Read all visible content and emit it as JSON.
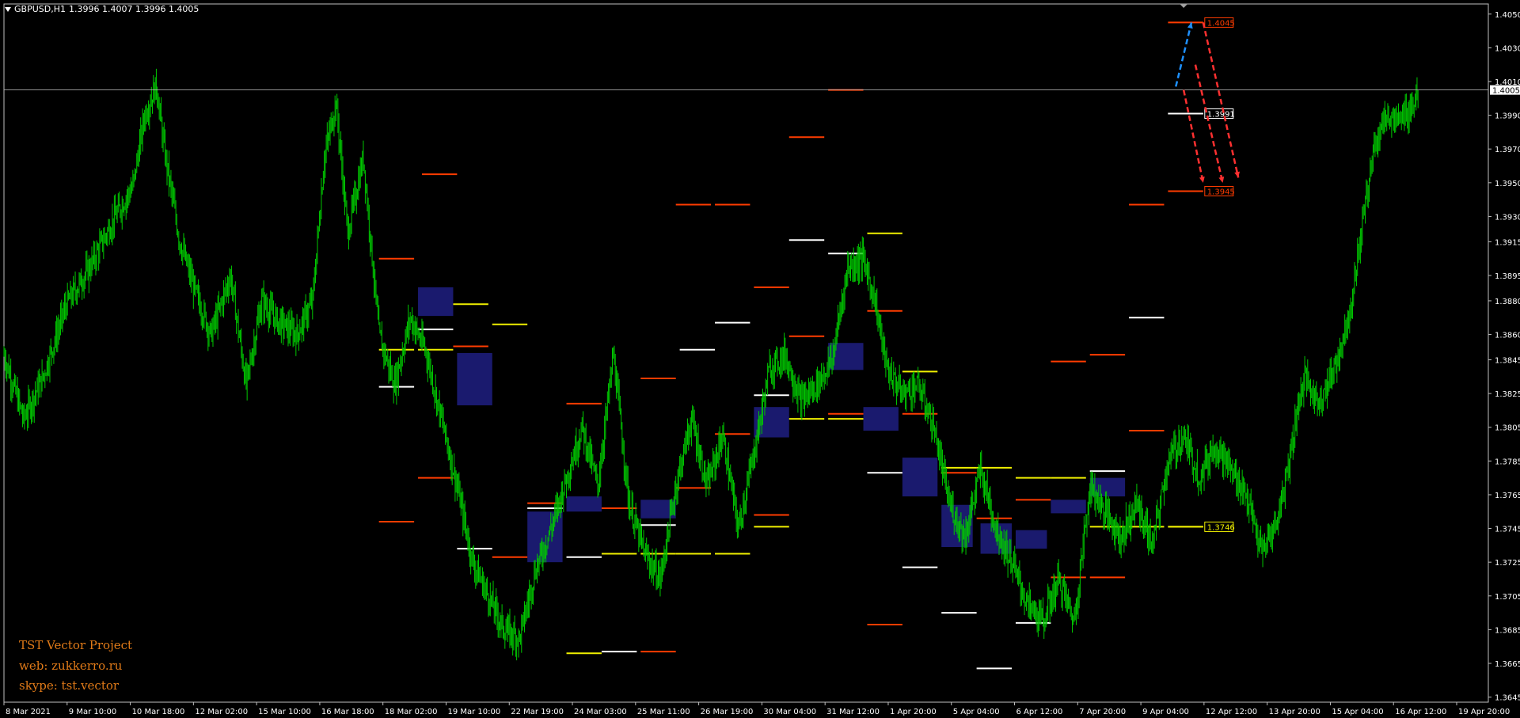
{
  "symbol_header": {
    "symbol": "GBPUSD,H1",
    "ohlc": "1.3996 1.4007 1.3996 1.4005"
  },
  "info_block": {
    "line1": "TST Vector Project",
    "line2": "web: zukkerro.ru",
    "line3": "skype: tst.vector"
  },
  "colors": {
    "background": "#000000",
    "candles": "#00c800",
    "grid_frame": "#c0c0c0",
    "level_red": "#ff3c00",
    "level_white": "#ffffff",
    "level_yellow": "#f0f000",
    "zone_fill": "#1a1a6e",
    "arrow_blue": "#1e90ff",
    "arrow_red": "#ff3030",
    "text_orange": "#e07a18"
  },
  "chart_data": {
    "type": "line",
    "symbol": "GBPUSD",
    "timeframe": "H1",
    "ylim": [
      1.3642,
      1.4056
    ],
    "y_ticks": [
      "1.4050",
      "1.4030",
      "1.4010",
      "1.3990",
      "1.3970",
      "1.3950",
      "1.3930",
      "1.3915",
      "1.3895",
      "1.3880",
      "1.3860",
      "1.3845",
      "1.3825",
      "1.3805",
      "1.3785",
      "1.3765",
      "1.3745",
      "1.3725",
      "1.3705",
      "1.3685",
      "1.3665",
      "1.3645"
    ],
    "x_ticks": [
      "8 Mar 2021",
      "9 Mar 10:00",
      "10 Mar 18:00",
      "12 Mar 02:00",
      "15 Mar 10:00",
      "16 Mar 18:00",
      "18 Mar 02:00",
      "19 Mar 10:00",
      "22 Mar 19:00",
      "24 Mar 03:00",
      "25 Mar 11:00",
      "26 Mar 19:00",
      "30 Mar 04:00",
      "31 Mar 12:00",
      "1 Apr 20:00",
      "5 Apr 04:00",
      "6 Apr 12:00",
      "7 Apr 20:00",
      "9 Apr 04:00",
      "12 Apr 12:00",
      "13 Apr 20:00",
      "15 Apr 04:00",
      "16 Apr 12:00",
      "19 Apr 20:00"
    ],
    "current_price": {
      "value": 1.4005,
      "label": "1.4005"
    },
    "price_path": [
      [
        0,
        1.3848
      ],
      [
        5,
        1.381
      ],
      [
        10,
        1.3835
      ],
      [
        16,
        1.3878
      ],
      [
        22,
        1.39
      ],
      [
        28,
        1.3928
      ],
      [
        33,
        1.3948
      ],
      [
        36,
        1.399
      ],
      [
        39,
        1.4008
      ],
      [
        41,
        1.397
      ],
      [
        45,
        1.3915
      ],
      [
        49,
        1.3885
      ],
      [
        53,
        1.386
      ],
      [
        58,
        1.3895
      ],
      [
        62,
        1.383
      ],
      [
        66,
        1.388
      ],
      [
        70,
        1.3868
      ],
      [
        75,
        1.386
      ],
      [
        79,
        1.388
      ],
      [
        82,
        1.3965
      ],
      [
        85,
        1.3998
      ],
      [
        88,
        1.392
      ],
      [
        92,
        1.3965
      ],
      [
        96,
        1.386
      ],
      [
        100,
        1.383
      ],
      [
        104,
        1.387
      ],
      [
        108,
        1.385
      ],
      [
        112,
        1.381
      ],
      [
        116,
        1.377
      ],
      [
        120,
        1.3725
      ],
      [
        124,
        1.3705
      ],
      [
        128,
        1.3685
      ],
      [
        132,
        1.368
      ],
      [
        136,
        1.372
      ],
      [
        140,
        1.3745
      ],
      [
        144,
        1.3775
      ],
      [
        148,
        1.3805
      ],
      [
        152,
        1.377
      ],
      [
        156,
        1.3848
      ],
      [
        160,
        1.376
      ],
      [
        164,
        1.373
      ],
      [
        168,
        1.3715
      ],
      [
        172,
        1.377
      ],
      [
        176,
        1.381
      ],
      [
        180,
        1.377
      ],
      [
        184,
        1.38
      ],
      [
        188,
        1.3745
      ],
      [
        192,
        1.379
      ],
      [
        196,
        1.384
      ],
      [
        200,
        1.3848
      ],
      [
        204,
        1.382
      ],
      [
        208,
        1.383
      ],
      [
        212,
        1.3845
      ],
      [
        216,
        1.39
      ],
      [
        220,
        1.3905
      ],
      [
        223,
        1.388
      ],
      [
        226,
        1.384
      ],
      [
        230,
        1.3825
      ],
      [
        234,
        1.383
      ],
      [
        238,
        1.3805
      ],
      [
        242,
        1.376
      ],
      [
        246,
        1.374
      ],
      [
        250,
        1.378
      ],
      [
        254,
        1.3745
      ],
      [
        258,
        1.3725
      ],
      [
        262,
        1.37
      ],
      [
        266,
        1.369
      ],
      [
        270,
        1.3715
      ],
      [
        274,
        1.369
      ],
      [
        278,
        1.377
      ],
      [
        282,
        1.3755
      ],
      [
        286,
        1.374
      ],
      [
        290,
        1.376
      ],
      [
        294,
        1.3735
      ],
      [
        298,
        1.3785
      ],
      [
        302,
        1.38
      ],
      [
        306,
        1.3775
      ],
      [
        310,
        1.3795
      ],
      [
        314,
        1.378
      ],
      [
        318,
        1.3765
      ],
      [
        322,
        1.373
      ],
      [
        326,
        1.375
      ],
      [
        329,
        1.3785
      ],
      [
        331,
        1.3815
      ],
      [
        333,
        1.3835
      ],
      [
        336,
        1.382
      ],
      [
        339,
        1.383
      ],
      [
        342,
        1.385
      ],
      [
        345,
        1.388
      ],
      [
        348,
        1.393
      ],
      [
        351,
        1.3975
      ],
      [
        354,
        1.399
      ],
      [
        357,
        1.3985
      ],
      [
        360,
        1.3995
      ],
      [
        362,
        1.4005
      ]
    ],
    "levels": [
      {
        "color": "red",
        "price": 1.4005,
        "from": 211,
        "to": 220
      },
      {
        "color": "red",
        "price": 1.3977,
        "from": 201,
        "to": 210
      },
      {
        "color": "red",
        "price": 1.3955,
        "from": 107,
        "to": 116
      },
      {
        "color": "red",
        "price": 1.3937,
        "from": 172,
        "to": 181
      },
      {
        "color": "red",
        "price": 1.3937,
        "from": 182,
        "to": 191
      },
      {
        "color": "red",
        "price": 1.3937,
        "from": 288,
        "to": 297
      },
      {
        "color": "red",
        "price": 1.3905,
        "from": 96,
        "to": 105
      },
      {
        "color": "red",
        "price": 1.3888,
        "from": 192,
        "to": 201
      },
      {
        "color": "red",
        "price": 1.3874,
        "from": 221,
        "to": 230
      },
      {
        "color": "red",
        "price": 1.3859,
        "from": 201,
        "to": 210
      },
      {
        "color": "red",
        "price": 1.3853,
        "from": 115,
        "to": 124
      },
      {
        "color": "red",
        "price": 1.3848,
        "from": 278,
        "to": 287
      },
      {
        "color": "red",
        "price": 1.3844,
        "from": 268,
        "to": 277
      },
      {
        "color": "red",
        "price": 1.3834,
        "from": 163,
        "to": 172
      },
      {
        "color": "red",
        "price": 1.3819,
        "from": 144,
        "to": 153
      },
      {
        "color": "red",
        "price": 1.3813,
        "from": 211,
        "to": 220
      },
      {
        "color": "red",
        "price": 1.3813,
        "from": 230,
        "to": 239
      },
      {
        "color": "red",
        "price": 1.3801,
        "from": 182,
        "to": 191
      },
      {
        "color": "red",
        "price": 1.3803,
        "from": 288,
        "to": 297
      },
      {
        "color": "red",
        "price": 1.3778,
        "from": 240,
        "to": 249
      },
      {
        "color": "red",
        "price": 1.3775,
        "from": 106,
        "to": 115
      },
      {
        "color": "red",
        "price": 1.3769,
        "from": 172,
        "to": 181
      },
      {
        "color": "red",
        "price": 1.3762,
        "from": 259,
        "to": 268
      },
      {
        "color": "red",
        "price": 1.376,
        "from": 134,
        "to": 143
      },
      {
        "color": "red",
        "price": 1.3757,
        "from": 153,
        "to": 162
      },
      {
        "color": "red",
        "price": 1.3753,
        "from": 192,
        "to": 201
      },
      {
        "color": "red",
        "price": 1.3751,
        "from": 249,
        "to": 258
      },
      {
        "color": "red",
        "price": 1.3749,
        "from": 96,
        "to": 105
      },
      {
        "color": "red",
        "price": 1.3728,
        "from": 125,
        "to": 134
      },
      {
        "color": "red",
        "price": 1.3716,
        "from": 268,
        "to": 277
      },
      {
        "color": "red",
        "price": 1.3716,
        "from": 278,
        "to": 287
      },
      {
        "color": "red",
        "price": 1.3688,
        "from": 221,
        "to": 230
      },
      {
        "color": "red",
        "price": 1.3672,
        "from": 163,
        "to": 172
      },
      {
        "color": "white",
        "price": 1.3916,
        "from": 201,
        "to": 210
      },
      {
        "color": "white",
        "price": 1.3908,
        "from": 211,
        "to": 220
      },
      {
        "color": "white",
        "price": 1.387,
        "from": 288,
        "to": 297
      },
      {
        "color": "white",
        "price": 1.3867,
        "from": 182,
        "to": 191
      },
      {
        "color": "white",
        "price": 1.3863,
        "from": 106,
        "to": 115
      },
      {
        "color": "white",
        "price": 1.3851,
        "from": 173,
        "to": 182
      },
      {
        "color": "white",
        "price": 1.3829,
        "from": 96,
        "to": 105
      },
      {
        "color": "white",
        "price": 1.3824,
        "from": 192,
        "to": 201
      },
      {
        "color": "white",
        "price": 1.3778,
        "from": 221,
        "to": 230
      },
      {
        "color": "white",
        "price": 1.3779,
        "from": 278,
        "to": 287
      },
      {
        "color": "white",
        "price": 1.3757,
        "from": 134,
        "to": 143
      },
      {
        "color": "white",
        "price": 1.3747,
        "from": 163,
        "to": 172
      },
      {
        "color": "white",
        "price": 1.3733,
        "from": 116,
        "to": 125
      },
      {
        "color": "white",
        "price": 1.3728,
        "from": 144,
        "to": 153
      },
      {
        "color": "white",
        "price": 1.3722,
        "from": 230,
        "to": 239
      },
      {
        "color": "white",
        "price": 1.3695,
        "from": 240,
        "to": 249
      },
      {
        "color": "white",
        "price": 1.3689,
        "from": 259,
        "to": 268
      },
      {
        "color": "white",
        "price": 1.3672,
        "from": 153,
        "to": 162
      },
      {
        "color": "white",
        "price": 1.3662,
        "from": 249,
        "to": 258
      },
      {
        "color": "white",
        "price": 1.3991,
        "from": 298,
        "to": 307
      },
      {
        "color": "yellow",
        "price": 1.392,
        "from": 221,
        "to": 230
      },
      {
        "color": "yellow",
        "price": 1.3878,
        "from": 115,
        "to": 124
      },
      {
        "color": "yellow",
        "price": 1.3866,
        "from": 125,
        "to": 134
      },
      {
        "color": "yellow",
        "price": 1.3851,
        "from": 96,
        "to": 105
      },
      {
        "color": "yellow",
        "price": 1.3851,
        "from": 106,
        "to": 115
      },
      {
        "color": "yellow",
        "price": 1.3838,
        "from": 230,
        "to": 239
      },
      {
        "color": "yellow",
        "price": 1.381,
        "from": 201,
        "to": 210
      },
      {
        "color": "yellow",
        "price": 1.381,
        "from": 211,
        "to": 220
      },
      {
        "color": "yellow",
        "price": 1.3781,
        "from": 240,
        "to": 249
      },
      {
        "color": "yellow",
        "price": 1.3781,
        "from": 249,
        "to": 258
      },
      {
        "color": "yellow",
        "price": 1.3775,
        "from": 259,
        "to": 268
      },
      {
        "color": "yellow",
        "price": 1.3775,
        "from": 268,
        "to": 277
      },
      {
        "color": "yellow",
        "price": 1.3746,
        "from": 192,
        "to": 201
      },
      {
        "color": "yellow",
        "price": 1.3746,
        "from": 278,
        "to": 287
      },
      {
        "color": "yellow",
        "price": 1.3746,
        "from": 288,
        "to": 297
      },
      {
        "color": "yellow",
        "price": 1.3746,
        "from": 298,
        "to": 307
      },
      {
        "color": "yellow",
        "price": 1.373,
        "from": 153,
        "to": 162
      },
      {
        "color": "yellow",
        "price": 1.373,
        "from": 163,
        "to": 172
      },
      {
        "color": "yellow",
        "price": 1.373,
        "from": 172,
        "to": 181
      },
      {
        "color": "yellow",
        "price": 1.373,
        "from": 182,
        "to": 191
      },
      {
        "color": "yellow",
        "price": 1.3671,
        "from": 144,
        "to": 153
      }
    ],
    "zones": [
      {
        "from": 106,
        "to": 115,
        "top": 1.3888,
        "bottom": 1.3871
      },
      {
        "from": 116,
        "to": 125,
        "top": 1.3849,
        "bottom": 1.3818
      },
      {
        "from": 134,
        "to": 143,
        "top": 1.3755,
        "bottom": 1.3725
      },
      {
        "from": 144,
        "to": 153,
        "top": 1.3764,
        "bottom": 1.3755
      },
      {
        "from": 163,
        "to": 172,
        "top": 1.3762,
        "bottom": 1.3751
      },
      {
        "from": 192,
        "to": 201,
        "top": 1.3817,
        "bottom": 1.3799
      },
      {
        "from": 211,
        "to": 220,
        "top": 1.3855,
        "bottom": 1.3839
      },
      {
        "from": 220,
        "to": 229,
        "top": 1.3817,
        "bottom": 1.3803
      },
      {
        "from": 230,
        "to": 239,
        "top": 1.3787,
        "bottom": 1.3764
      },
      {
        "from": 240,
        "to": 248,
        "top": 1.3759,
        "bottom": 1.3734
      },
      {
        "from": 250,
        "to": 258,
        "top": 1.3748,
        "bottom": 1.373
      },
      {
        "from": 259,
        "to": 267,
        "top": 1.3744,
        "bottom": 1.3733
      },
      {
        "from": 268,
        "to": 277,
        "top": 1.3762,
        "bottom": 1.3754
      },
      {
        "from": 278,
        "to": 287,
        "top": 1.3775,
        "bottom": 1.3764
      }
    ],
    "tags": [
      {
        "label": "1.4045",
        "price": 1.4045,
        "color": "red"
      },
      {
        "label": "1.3991",
        "price": 1.3991,
        "color": "white"
      },
      {
        "label": "1.3945",
        "price": 1.3945,
        "color": "red"
      },
      {
        "label": "1.3746",
        "price": 1.3746,
        "color": "yellow"
      }
    ],
    "forecast_arrows": [
      {
        "color": "blue",
        "from": [
          300,
          1.4007
        ],
        "to": [
          304,
          1.4045
        ]
      },
      {
        "color": "red",
        "from": [
          302,
          1.4005
        ],
        "to": [
          307,
          1.395
        ]
      },
      {
        "color": "red",
        "from": [
          305,
          1.402
        ],
        "to": [
          312,
          1.395
        ]
      },
      {
        "color": "red",
        "from": [
          307,
          1.4045
        ],
        "to": [
          316,
          1.3953
        ]
      }
    ]
  }
}
